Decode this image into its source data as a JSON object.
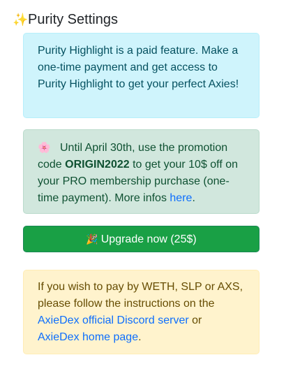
{
  "header": {
    "icon": "✨",
    "title": "Purity Settings"
  },
  "info_alert": {
    "text": "Purity Highlight is a paid feature. Make a one-time payment and get access to Purity Highlight to get your perfect Axies!"
  },
  "promo_alert": {
    "icon": "🌸",
    "text_before": "Until April 30th, use the promotion code",
    "code": "ORIGIN2022",
    "text_after": "to get your 10$ off on your PRO membership purchase (one-time payment). More infos",
    "link_label": "here",
    "end": "."
  },
  "upgrade_button": {
    "icon": "🎉",
    "label": "Upgrade now (25$)"
  },
  "payment_alert": {
    "text": "If you wish to pay by WETH, SLP or AXS, please follow the instructions on the",
    "discord_link_label": "AxieDex official Discord server",
    "or_text": "or",
    "home_link_label": "AxieDex home page",
    "end": "."
  },
  "colors": {
    "info_bg": "#cff4fc",
    "success_bg": "#d1e7dd",
    "warning_bg": "#fff3cd",
    "button_bg": "#19a045",
    "link": "#0d6efd"
  }
}
